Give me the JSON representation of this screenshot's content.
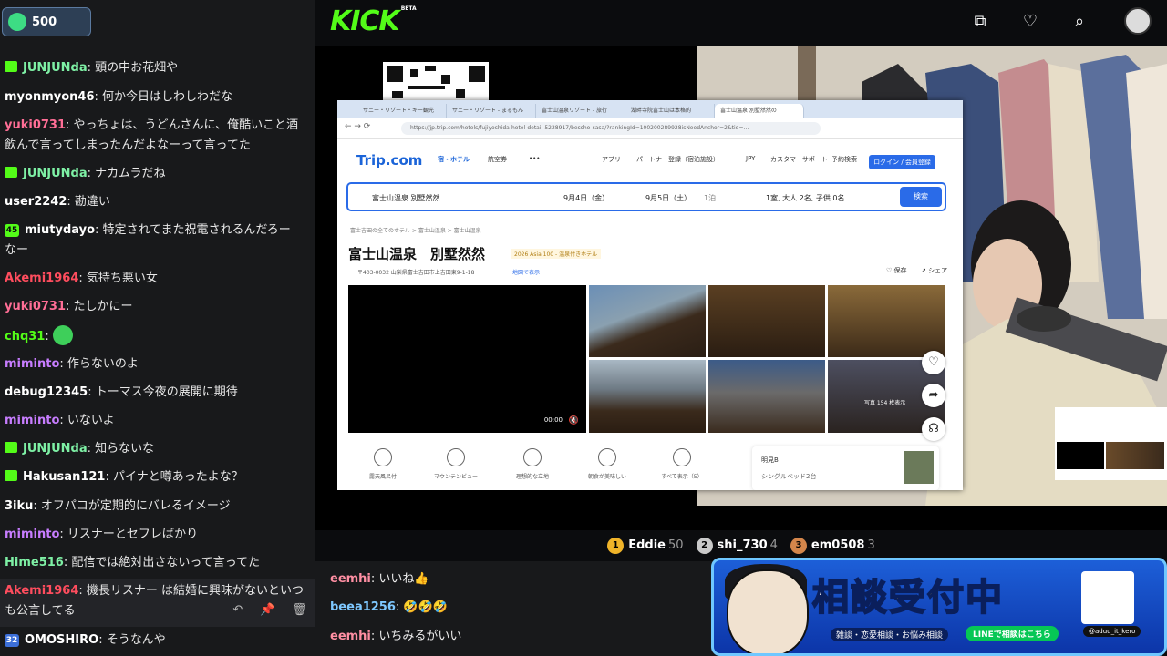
{
  "chat": {
    "points": "500",
    "messages": [
      {
        "user": "JUNJUNda",
        "text": "頭の中お花畑や",
        "color": "#7ef0a5",
        "badge": "gift"
      },
      {
        "user": "myonmyon46",
        "text": "何か今日はしわしわだな",
        "color": "#ffffff",
        "badge": ""
      },
      {
        "user": "yuki0731",
        "text": "やっちょは、うどんさんに、俺酷いこと酒",
        "text2": "飲んで言ってしまったんだよなーって言ってた",
        "color": "#ff6e96",
        "badge": ""
      },
      {
        "user": "JUNJUNda",
        "text": "ナカムラだね",
        "color": "#7ef0a5",
        "badge": "gift"
      },
      {
        "user": "user2242",
        "text": "勘違い",
        "color": "#ffffff",
        "badge": ""
      },
      {
        "user": "miutydayo",
        "text": "特定されてまた祝電されるんだろー",
        "text2": "なー",
        "color": "#ffffff",
        "badge": "45"
      },
      {
        "user": "Akemi1964",
        "text": "気持ち悪い女",
        "color": "#ff4d5e",
        "badge": ""
      },
      {
        "user": "yuki0731",
        "text": "たしかにー",
        "color": "#ff6e96",
        "badge": ""
      },
      {
        "user": "chq31",
        "text": "",
        "color": "#53fc18",
        "badge": "",
        "emote": true
      },
      {
        "user": "miminto",
        "text": "作らないのよ",
        "color": "#c77dff",
        "badge": ""
      },
      {
        "user": "debug12345",
        "text": "トーマス今夜の展開に期待",
        "color": "#ffffff",
        "badge": ""
      },
      {
        "user": "miminto",
        "text": "いないよ",
        "color": "#c77dff",
        "badge": ""
      },
      {
        "user": "JUNJUNda",
        "text": "知らないな",
        "color": "#7ef0a5",
        "badge": "gift"
      },
      {
        "user": "Hakusan121",
        "text": "パイナと噂あったよな？",
        "color": "#ffffff",
        "badge": "gift"
      },
      {
        "user": "3iku",
        "text": "オフパコが定期的にバレるイメージ",
        "color": "#ffffff",
        "badge": ""
      },
      {
        "user": "miminto",
        "text": "リスナーとセフレばかり",
        "color": "#c77dff",
        "badge": ""
      },
      {
        "user": "Hime516",
        "text": "配信では絶対出さないって言ってた",
        "color": "#7ef0a5",
        "badge": ""
      },
      {
        "user": "Akemi1964",
        "text": "機長リスナー は結婚に興味がないといつ",
        "text2": "も公言してる",
        "color": "#ff4d5e",
        "badge": ""
      },
      {
        "user": "OMOSHIRO",
        "text": "そうなんや",
        "color": "#ffffff",
        "badge": "32"
      }
    ]
  },
  "header": {
    "logo": "KICK",
    "logo_tag": "BETA"
  },
  "browser": {
    "tabs": [
      "サニー・リゾート・キー観光",
      "サニー・リゾート - まるもん",
      "富士山温泉リゾート - 旅行",
      "湖畔寺院富士山は本格的",
      "富士山温泉 別墅然然の"
    ],
    "url": "https://jp.trip.com/hotels/fujiyoshida-hotel-detail-5228917/bessho-sasa/?rankingId=100200289928isNeedAnchor=2&tid=...",
    "site_logo": "Trip.com",
    "nav": [
      "宿・ホテル",
      "航空券",
      "•••"
    ],
    "nav_right": [
      "アプリ",
      "パートナー登録（宿泊施設）",
      "JPY",
      "カスタマーサポート",
      "予約検索"
    ],
    "login": "ログイン / 会員登録",
    "search_place": "富士山温泉 別墅然然",
    "date_in": "9月4日（金）",
    "date_out": "9月5日（土）",
    "nights": "1泊",
    "guests": "1室, 大人 2名, 子供 0名",
    "search_btn": "検索",
    "breadcrumb": "富士吉田の全てのホテル  >  富士山温泉  >  富士山温泉",
    "hotel_name": "富士山温泉　別墅然然",
    "award": "2026 Asia 100 - 温泉付きホテル",
    "address": "〒403-0032 山梨県富士吉田市上吉田東9-1-18",
    "map_link": "地図で表示",
    "save": "保存",
    "share": "シェア",
    "video_time": "00:00",
    "photo_count": "写真 154 枚表示",
    "amenities": [
      "露天風呂付",
      "マウンテンビュー",
      "理想的な立地",
      "朝食が美味しい",
      "すべて表示（5）"
    ],
    "room_label": "明見B",
    "room_bed": "シングルベッド2台"
  },
  "leaderboard": [
    {
      "rank": "1",
      "user": "Eddie",
      "points": "50",
      "color": "#f0b429"
    },
    {
      "rank": "2",
      "user": "shi_730",
      "points": "4",
      "color": "#c9c9c9"
    },
    {
      "rank": "3",
      "user": "em0508",
      "points": "3",
      "color": "#d4864b"
    }
  ],
  "bottom_chat": [
    {
      "user": "eemhi",
      "text": "いいね👍",
      "color": "#ff8fa3"
    },
    {
      "user": "beea1256",
      "text": "🤣🤣🤣",
      "color": "#7ec8ff"
    },
    {
      "user": "eemhi",
      "text": "いちみるがいい",
      "color": "#ff8fa3"
    }
  ],
  "banner": {
    "title_a": "相談",
    "title_b": "受付中",
    "sub": "雑談・恋愛相談・お悩み相談",
    "line": "LINEで相談はこちら",
    "x": "@aduu_it_kero"
  }
}
